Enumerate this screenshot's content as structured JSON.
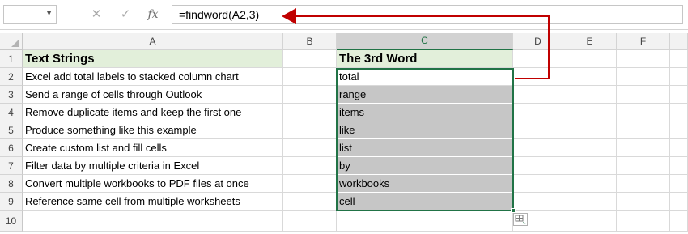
{
  "formula_bar": {
    "name_box_value": "",
    "cancel_glyph": "✕",
    "enter_glyph": "✓",
    "fx_glyph": "fx",
    "formula": "=findword(A2,3)"
  },
  "columns": [
    "A",
    "B",
    "C",
    "D",
    "E",
    "F"
  ],
  "selected_column": "C",
  "rows": [
    "1",
    "2",
    "3",
    "4",
    "5",
    "6",
    "7",
    "8",
    "9",
    "10"
  ],
  "cells": {
    "A": [
      "Text Strings",
      "Excel add total labels to stacked column chart",
      "Send a range of cells through Outlook",
      "Remove duplicate items and keep the first one",
      "Produce something like this example",
      "Create custom list and fill cells",
      "Filter data by multiple criteria in Excel",
      "Convert multiple workbooks to PDF files at once",
      "Reference same cell from multiple worksheets"
    ],
    "C": [
      "The 3rd Word",
      "total",
      "range",
      "items",
      "like",
      "list",
      "by",
      "workbooks",
      "cell"
    ]
  },
  "colors": {
    "header_fill": "#e2efda",
    "selection_fill": "#c6c6c6",
    "selection_border": "#217346",
    "annotation_arrow": "#c00000"
  },
  "icons": {
    "name_box_dropdown": "chevron-down-icon",
    "cancel": "close-icon",
    "enter": "checkmark-icon",
    "insert_function": "fx-icon",
    "quick_analysis": "quick-analysis-icon",
    "select_all": "select-all-triangle-icon"
  }
}
